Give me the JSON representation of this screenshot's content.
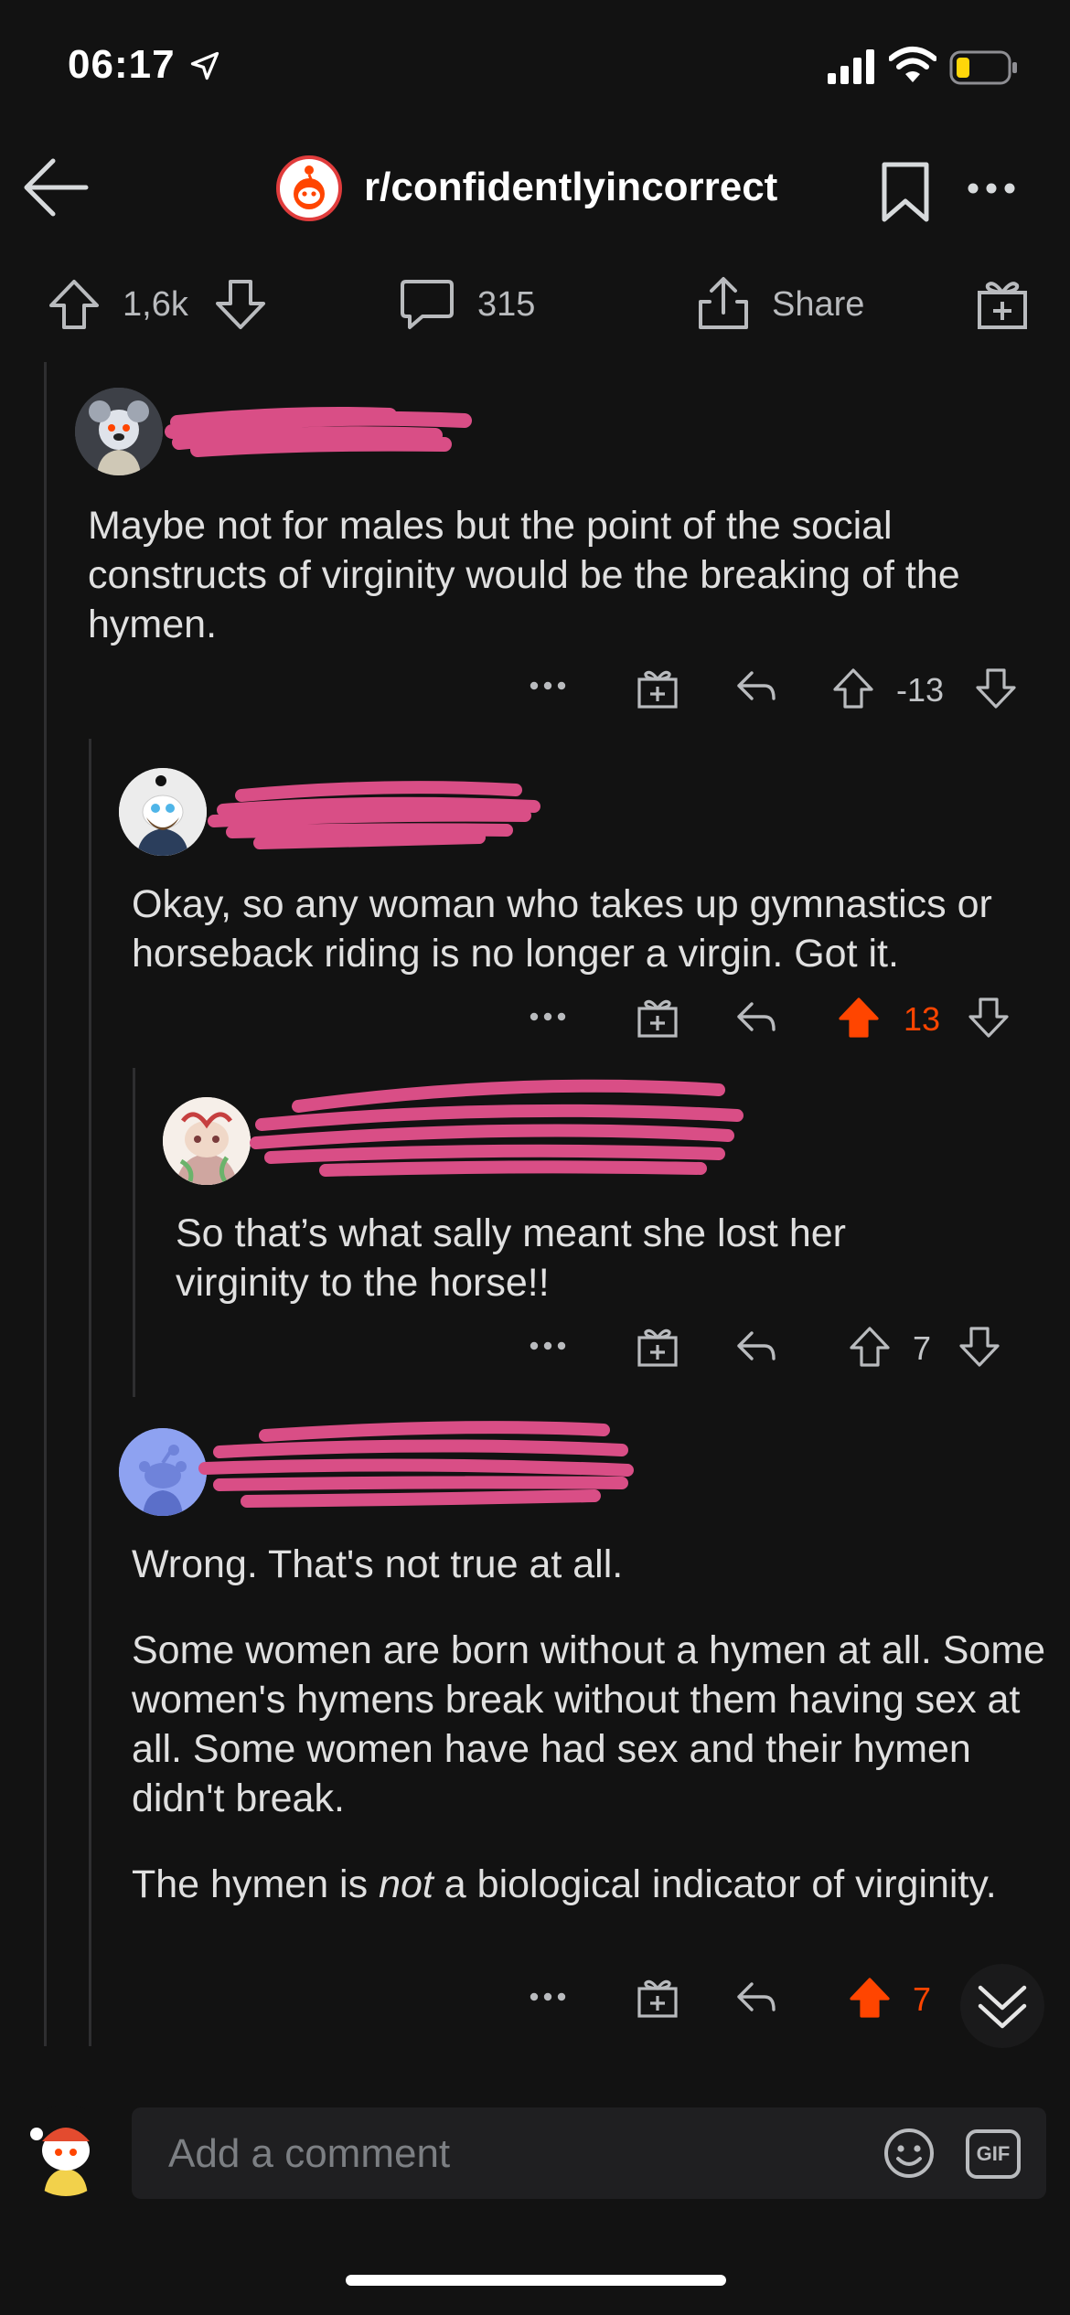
{
  "status_bar": {
    "time": "06:17"
  },
  "header": {
    "subreddit": "r/confidentlyincorrect"
  },
  "post_actions": {
    "upvotes": "1,6k",
    "comments": "315",
    "share_label": "Share"
  },
  "comments": [
    {
      "paragraphs": [
        "Maybe not for males but the point of the social constructs of virginity would be the breaking of the hymen."
      ],
      "score": "-13",
      "upvoted": false
    },
    {
      "paragraphs": [
        "Okay, so any woman who takes up gymnastics or horseback riding is no longer a virgin. Got it."
      ],
      "score": "13",
      "upvoted": true
    },
    {
      "paragraphs": [
        "So that’s what sally meant she lost her virginity to the horse!!"
      ],
      "score": "7",
      "upvoted": false
    },
    {
      "paragraphs": [
        "Wrong. That's not true at all.",
        "Some women are born without a hymen at all. Some women's hymens break without them having sex at all. Some women have had sex and their hymen didn't break."
      ],
      "last_paragraph": {
        "before": "The hymen is ",
        "emphasis": "not",
        "after": " a biological indicator of virginity."
      },
      "score": "7",
      "upvoted": true
    }
  ],
  "composer": {
    "placeholder": "Add a comment",
    "gif_label": "GIF"
  },
  "colors": {
    "background": "#121212",
    "upvote_accent": "#ff4500",
    "redaction": "#d94e86"
  }
}
